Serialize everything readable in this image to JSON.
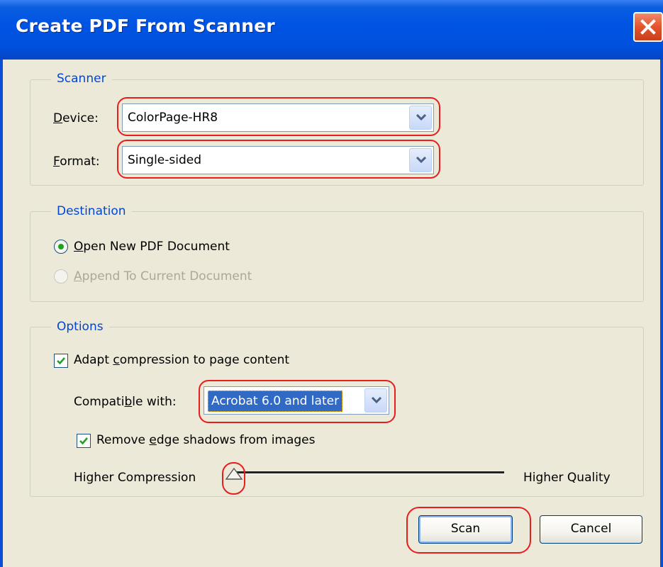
{
  "window": {
    "title": "Create PDF From Scanner"
  },
  "scanner": {
    "legend": "Scanner",
    "device_label_mnemonic": "D",
    "device_label_rest": "evice:",
    "device_value": "ColorPage-HR8",
    "format_label_mnemonic": "F",
    "format_label_rest": "ormat:",
    "format_value": "Single-sided"
  },
  "destination": {
    "legend": "Destination",
    "open_new_mnemonic": "O",
    "open_new_rest": "pen New PDF Document",
    "open_new_selected": true,
    "append_mnemonic": "A",
    "append_rest": "ppend To Current Document",
    "append_enabled": false
  },
  "options": {
    "legend": "Options",
    "adapt_pre": "Adapt ",
    "adapt_mnemonic": "c",
    "adapt_post": "ompression to page content",
    "adapt_checked": true,
    "compatible_pre": "Compati",
    "compatible_mnemonic": "b",
    "compatible_post": "le with:",
    "compatible_value": "Acrobat 6.0 and later",
    "remove_pre": "Remove ",
    "remove_mnemonic": "e",
    "remove_post": "dge shadows from images",
    "remove_checked": true,
    "slider_left_label": "Higher Compression",
    "slider_right_label": "Higher Quality",
    "slider_position": 0
  },
  "buttons": {
    "scan": "Scan",
    "cancel": "Cancel"
  },
  "colors": {
    "titlebar": "#0054e3",
    "dialog_bg": "#ece9d8",
    "legend_text": "#0046d5",
    "selection": "#316ac5",
    "annotation": "#e61e1e"
  }
}
